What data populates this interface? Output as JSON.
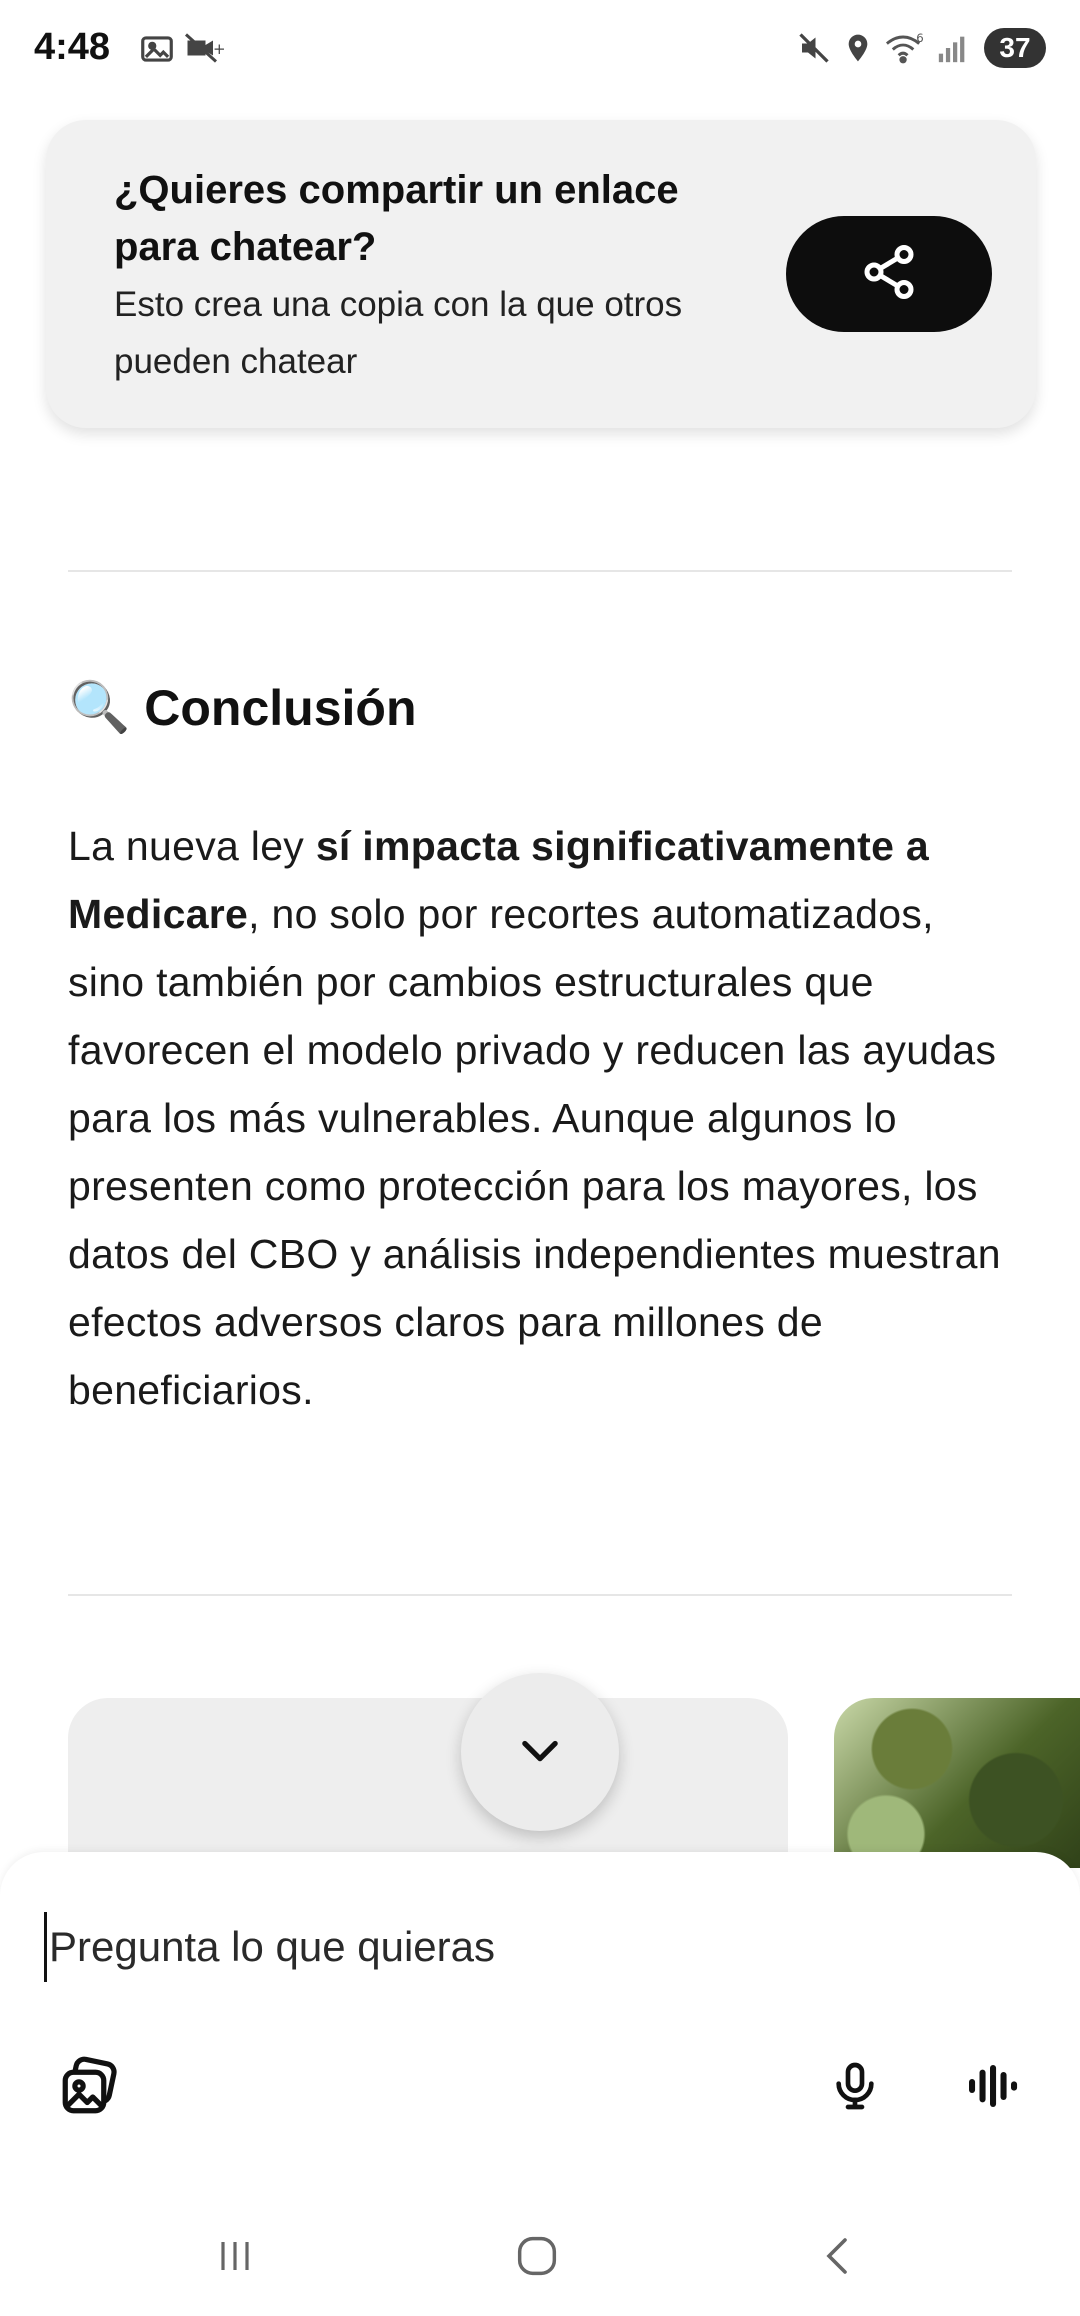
{
  "status_bar": {
    "time": "4:48",
    "battery": "37",
    "icons": [
      "screenshot-icon",
      "no-video-icon",
      "mute-icon",
      "location-icon",
      "wifi-icon",
      "signal-icon"
    ]
  },
  "share_card": {
    "title": "¿Quieres compartir un enlace para chatear?",
    "subtitle": "Esto crea una copia con la que otros pueden chatear",
    "button_icon": "share-icon"
  },
  "section": {
    "emoji": "🔍",
    "title": "Conclusión",
    "paragraph": {
      "intro": "La nueva ley ",
      "bold": "sí impacta significativamente a Medicare",
      "rest": ", no solo por recortes automatizados, sino también por cambios estructurales que favorecen el modelo privado y reducen las ayudas para los más vulnerables. Aunque algunos lo presenten como protección para los mayores, los datos del CBO y análisis independientes muestran efectos adversos claros para millones de beneficiarios."
    }
  },
  "composer": {
    "placeholder": "Pregunta lo que quieras",
    "value": ""
  },
  "colors": {
    "share_button": "#0d0d0d",
    "card_bg": "#f1f1f1",
    "text": "#111111"
  }
}
